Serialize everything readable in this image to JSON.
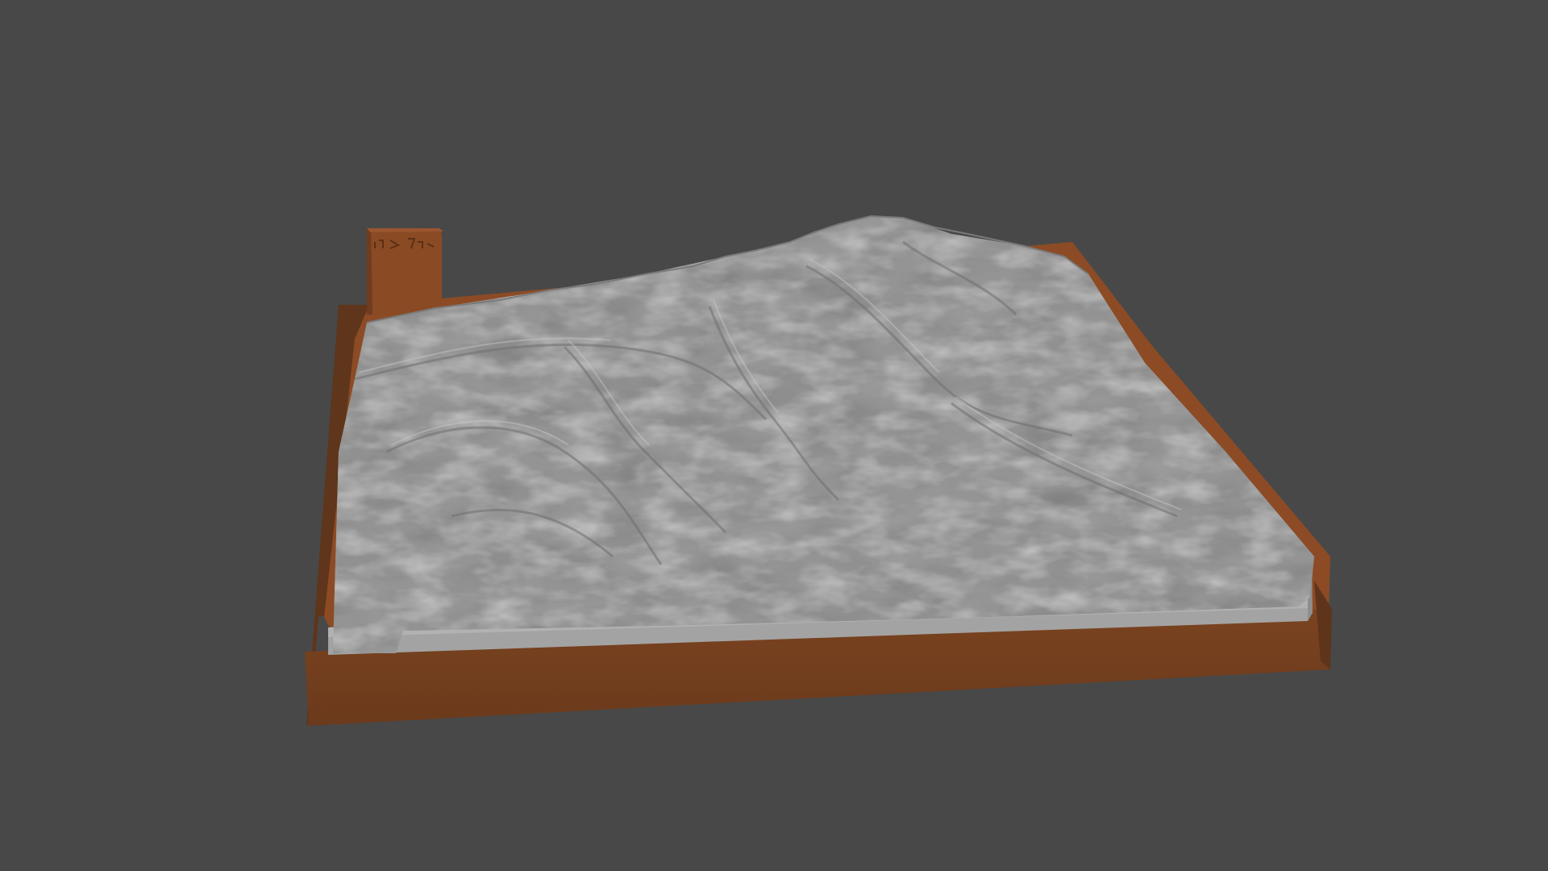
{
  "scene": {
    "subject": "terrain-relief-model",
    "colors": {
      "background": "#484848",
      "base_top": "#8c4b25",
      "base_front": "#74401f",
      "base_right": "#5e341b",
      "base_left": "#5f351b",
      "terrain_light": "#b7b7b7",
      "terrain_mid": "#9d9d9d",
      "terrain_dark": "#6b6b6b",
      "terrain_side": "#a6a6a6"
    }
  }
}
